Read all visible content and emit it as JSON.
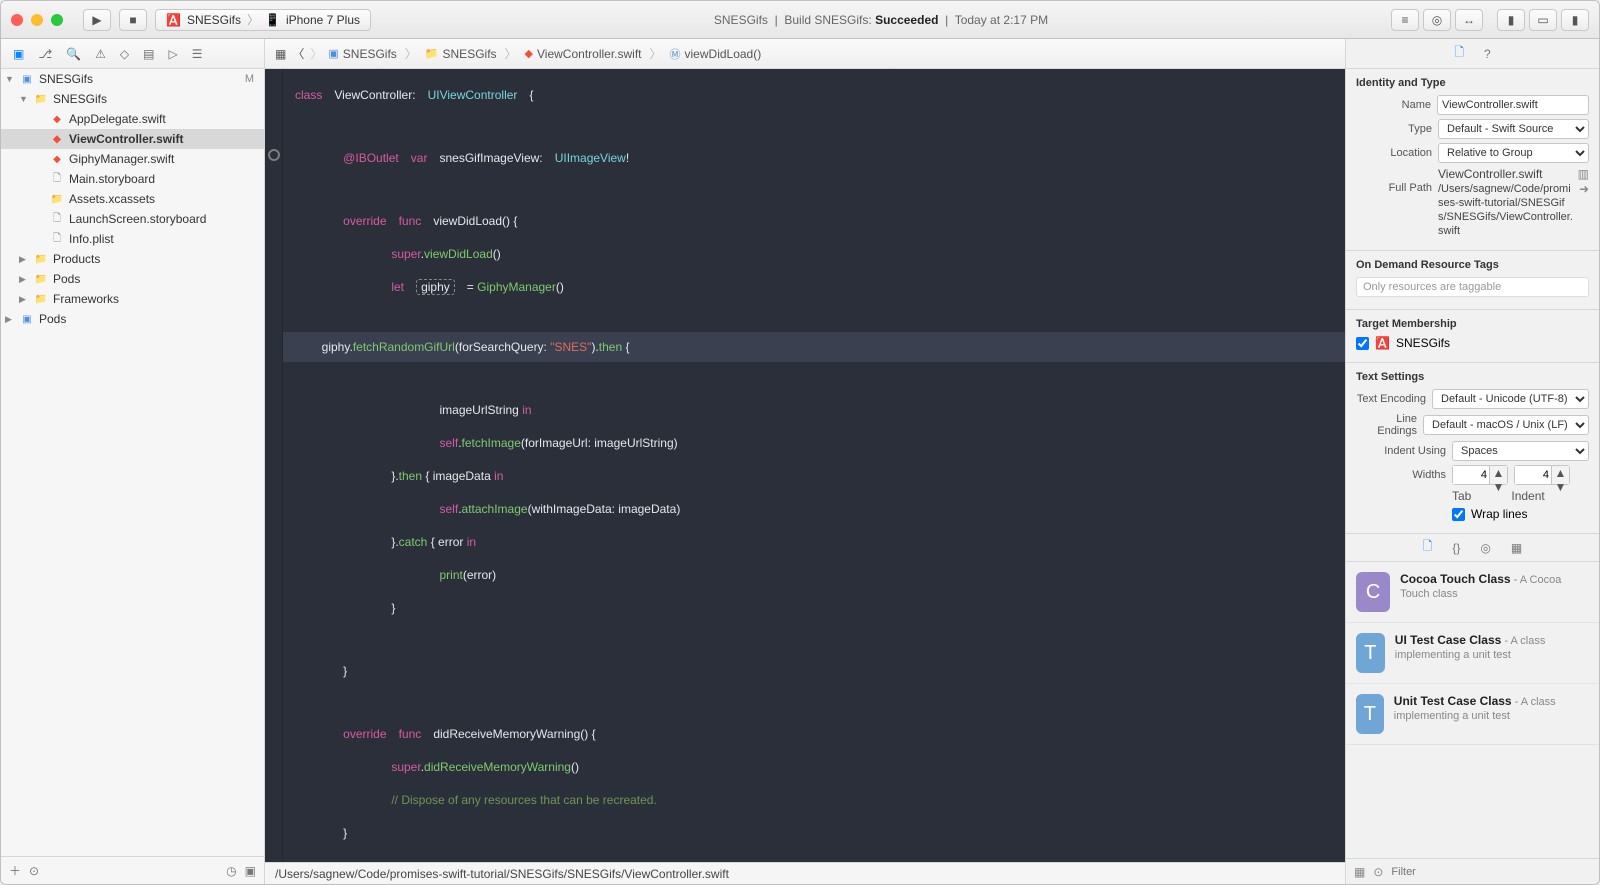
{
  "titlebar": {
    "scheme_app": "SNESGifs",
    "scheme_device": "iPhone 7 Plus",
    "center_project": "SNESGifs",
    "center_action": "Build SNESGifs:",
    "center_status": "Succeeded",
    "center_time": "Today at 2:17 PM"
  },
  "breadcrumbs": [
    "SNESGifs",
    "SNESGifs",
    "ViewController.swift",
    "viewDidLoad()"
  ],
  "navigator": {
    "root": "SNESGifs",
    "modified_badge": "M",
    "items": [
      {
        "label": "SNESGifs",
        "type": "folder",
        "indent": 1,
        "open": true
      },
      {
        "label": "AppDelegate.swift",
        "type": "swift",
        "indent": 2
      },
      {
        "label": "ViewController.swift",
        "type": "swift",
        "indent": 2,
        "selected": true
      },
      {
        "label": "GiphyManager.swift",
        "type": "swift",
        "indent": 2
      },
      {
        "label": "Main.storyboard",
        "type": "file",
        "indent": 2
      },
      {
        "label": "Assets.xcassets",
        "type": "folder-closed",
        "indent": 2
      },
      {
        "label": "LaunchScreen.storyboard",
        "type": "file",
        "indent": 2
      },
      {
        "label": "Info.plist",
        "type": "file",
        "indent": 2
      },
      {
        "label": "Products",
        "type": "folder",
        "indent": 1,
        "collapsed": true
      },
      {
        "label": "Pods",
        "type": "folder",
        "indent": 1,
        "collapsed": true
      },
      {
        "label": "Frameworks",
        "type": "folder",
        "indent": 1,
        "collapsed": true
      },
      {
        "label": "Pods",
        "type": "project",
        "indent": 0,
        "collapsed": true
      }
    ]
  },
  "code": {
    "tokens": [
      [
        {
          "t": "kw",
          "v": "class"
        },
        {
          "t": "sp",
          "v": " "
        },
        {
          "t": "nm",
          "v": "ViewController:"
        },
        {
          "t": "sp",
          "v": " "
        },
        {
          "t": "ty",
          "v": "UIViewController"
        },
        {
          "t": "sp",
          "v": " "
        },
        {
          "t": "nm",
          "v": "{"
        }
      ],
      [],
      [
        {
          "t": "sp",
          "v": "    "
        },
        {
          "t": "ib",
          "v": "@IBOutlet"
        },
        {
          "t": "sp",
          "v": " "
        },
        {
          "t": "kw",
          "v": "var"
        },
        {
          "t": "sp",
          "v": " "
        },
        {
          "t": "nm",
          "v": "snesGifImageView:"
        },
        {
          "t": "sp",
          "v": " "
        },
        {
          "t": "ty",
          "v": "UIImageView"
        },
        {
          "t": "nm",
          "v": "!"
        }
      ],
      [],
      [
        {
          "t": "sp",
          "v": "    "
        },
        {
          "t": "kw",
          "v": "override"
        },
        {
          "t": "sp",
          "v": " "
        },
        {
          "t": "kw",
          "v": "func"
        },
        {
          "t": "sp",
          "v": " "
        },
        {
          "t": "nm",
          "v": "viewDidLoad() {"
        }
      ],
      [
        {
          "t": "sp",
          "v": "        "
        },
        {
          "t": "su",
          "v": "super"
        },
        {
          "t": "nm",
          "v": "."
        },
        {
          "t": "fn",
          "v": "viewDidLoad"
        },
        {
          "t": "nm",
          "v": "()"
        }
      ],
      [
        {
          "t": "sp",
          "v": "        "
        },
        {
          "t": "kw",
          "v": "let"
        },
        {
          "t": "sp",
          "v": " "
        },
        {
          "t": "dash",
          "v": "giphy"
        },
        {
          "t": "sp",
          "v": " "
        },
        {
          "t": "nm",
          "v": "= "
        },
        {
          "t": "fn",
          "v": "GiphyManager"
        },
        {
          "t": "nm",
          "v": "()"
        }
      ],
      [],
      [
        {
          "t": "sp",
          "v": "        "
        },
        {
          "t": "hi",
          "v": true
        },
        {
          "t": "nm",
          "v": "giphy."
        },
        {
          "t": "fn",
          "v": "fetchRandomGifUrl"
        },
        {
          "t": "nm",
          "v": "(forSearchQuery: "
        },
        {
          "t": "st",
          "v": "\"SNES\""
        },
        {
          "t": "nm",
          "v": ")."
        },
        {
          "t": "fn",
          "v": "then"
        },
        {
          "t": "nm",
          "v": " {"
        }
      ],
      [
        {
          "t": "sp",
          "v": "            "
        },
        {
          "t": "nm",
          "v": "imageUrlString "
        },
        {
          "t": "kw",
          "v": "in"
        }
      ],
      [
        {
          "t": "sp",
          "v": "            "
        },
        {
          "t": "su",
          "v": "self"
        },
        {
          "t": "nm",
          "v": "."
        },
        {
          "t": "fn",
          "v": "fetchImage"
        },
        {
          "t": "nm",
          "v": "(forImageUrl: imageUrlString)"
        }
      ],
      [
        {
          "t": "sp",
          "v": "        "
        },
        {
          "t": "nm",
          "v": "}."
        },
        {
          "t": "fn",
          "v": "then"
        },
        {
          "t": "nm",
          "v": " { imageData "
        },
        {
          "t": "kw",
          "v": "in"
        }
      ],
      [
        {
          "t": "sp",
          "v": "            "
        },
        {
          "t": "su",
          "v": "self"
        },
        {
          "t": "nm",
          "v": "."
        },
        {
          "t": "fn",
          "v": "attachImage"
        },
        {
          "t": "nm",
          "v": "(withImageData: imageData)"
        }
      ],
      [
        {
          "t": "sp",
          "v": "        "
        },
        {
          "t": "nm",
          "v": "}."
        },
        {
          "t": "fn",
          "v": "catch"
        },
        {
          "t": "nm",
          "v": " { error "
        },
        {
          "t": "kw",
          "v": "in"
        }
      ],
      [
        {
          "t": "sp",
          "v": "            "
        },
        {
          "t": "fn",
          "v": "print"
        },
        {
          "t": "nm",
          "v": "(error)"
        }
      ],
      [
        {
          "t": "sp",
          "v": "        "
        },
        {
          "t": "nm",
          "v": "}"
        }
      ],
      [],
      [
        {
          "t": "sp",
          "v": "    "
        },
        {
          "t": "nm",
          "v": "}"
        }
      ],
      [],
      [
        {
          "t": "sp",
          "v": "    "
        },
        {
          "t": "kw",
          "v": "override"
        },
        {
          "t": "sp",
          "v": " "
        },
        {
          "t": "kw",
          "v": "func"
        },
        {
          "t": "sp",
          "v": " "
        },
        {
          "t": "nm",
          "v": "didReceiveMemoryWarning() {"
        }
      ],
      [
        {
          "t": "sp",
          "v": "        "
        },
        {
          "t": "su",
          "v": "super"
        },
        {
          "t": "nm",
          "v": "."
        },
        {
          "t": "fn",
          "v": "didReceiveMemoryWarning"
        },
        {
          "t": "nm",
          "v": "()"
        }
      ],
      [
        {
          "t": "sp",
          "v": "        "
        },
        {
          "t": "cm",
          "v": "// Dispose of any resources that can be recreated."
        }
      ],
      [
        {
          "t": "sp",
          "v": "    "
        },
        {
          "t": "nm",
          "v": "}"
        }
      ]
    ]
  },
  "status_path": "/Users/sagnew/Code/promises-swift-tutorial/SNESGifs/SNESGifs/ViewController.swift",
  "inspector": {
    "identity": {
      "title": "Identity and Type",
      "name_lbl": "Name",
      "name_val": "ViewController.swift",
      "type_lbl": "Type",
      "type_val": "Default - Swift Source",
      "location_lbl": "Location",
      "location_val": "Relative to Group",
      "rel_file": "ViewController.swift",
      "fullpath_lbl": "Full Path",
      "fullpath": "/Users/sagnew/Code/promises-swift-tutorial/SNESGifs/SNESGifs/ViewController.swift"
    },
    "odr": {
      "title": "On Demand Resource Tags",
      "placeholder": "Only resources are taggable"
    },
    "target": {
      "title": "Target Membership",
      "item": "SNESGifs"
    },
    "text": {
      "title": "Text Settings",
      "enc_lbl": "Text Encoding",
      "enc_val": "Default - Unicode (UTF-8)",
      "le_lbl": "Line Endings",
      "le_val": "Default - macOS / Unix (LF)",
      "iu_lbl": "Indent Using",
      "iu_val": "Spaces",
      "widths_lbl": "Widths",
      "tab_val": "4",
      "indent_val": "4",
      "tab_lbl": "Tab",
      "indent_lbl": "Indent",
      "wrap_lbl": "Wrap lines"
    },
    "library": [
      {
        "letter": "C",
        "color": "purple",
        "title": "Cocoa Touch Class",
        "desc": " - A Cocoa Touch class"
      },
      {
        "letter": "T",
        "color": "blue",
        "title": "UI Test Case Class",
        "desc": " - A class implementing a unit test"
      },
      {
        "letter": "T",
        "color": "blue",
        "title": "Unit Test Case Class",
        "desc": " - A class implementing a unit test"
      }
    ],
    "filter_placeholder": "Filter"
  }
}
